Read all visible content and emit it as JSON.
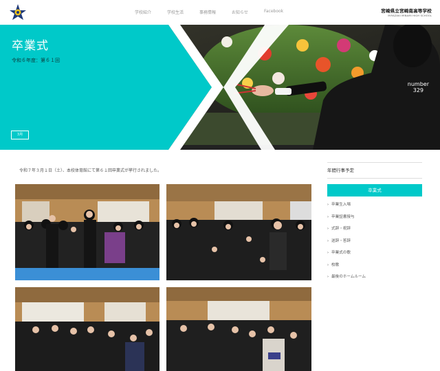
{
  "header": {
    "nav": [
      "学校紹介",
      "学校生活",
      "事務情報",
      "お知らせ",
      "Facebook"
    ],
    "school_name_jp": "宮崎県立宮崎南高等学校",
    "school_name_en": "MIYAZAKI MINAMI HIGH SCHOOL"
  },
  "hero": {
    "title": "卒業式",
    "subtitle": "令和６年度：第６１回",
    "month_button": "3月",
    "number_label": "number",
    "number_value": "329",
    "accent_color": "#00c9c9"
  },
  "main": {
    "lead": "令和７年３月１日（土）、本校体育館にて第６１回卒業式が挙行されました。"
  },
  "sidebar": {
    "title": "年間行事予定",
    "category": "卒業式",
    "items": [
      "卒業生入場",
      "卒業証書授与",
      "式辞・祝辞",
      "送辞・答辞",
      "卒業式の歌",
      "校歌",
      "最後のホームルーム"
    ]
  }
}
